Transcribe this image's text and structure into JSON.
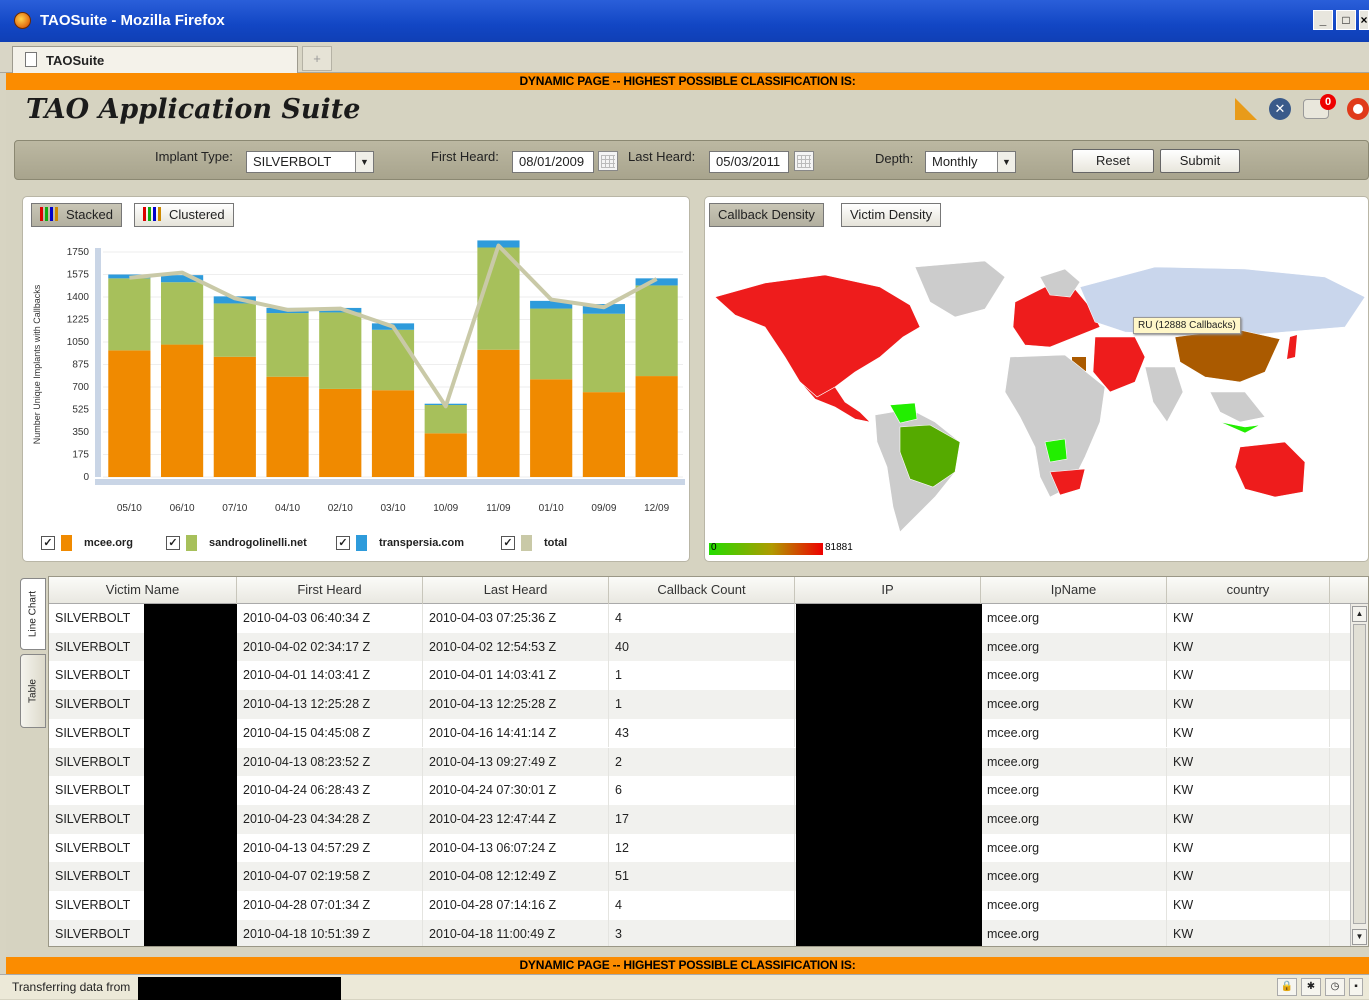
{
  "window": {
    "title": "TAOSuite - Mozilla Firefox",
    "tab_label": "TAOSuite",
    "new_tab": "+"
  },
  "banner": {
    "text": "DYNAMIC PAGE -- HIGHEST POSSIBLE CLASSIFICATION IS:"
  },
  "app": {
    "title": "TAO Application Suite",
    "notification_count": "0"
  },
  "filters": {
    "implant_type_label": "Implant Type:",
    "implant_type_value": "SILVERBOLT",
    "first_heard_label": "First Heard:",
    "first_heard_value": "08/01/2009",
    "last_heard_label": "Last Heard:",
    "last_heard_value": "05/03/2011",
    "depth_label": "Depth:",
    "depth_value": "Monthly",
    "reset_label": "Reset",
    "submit_label": "Submit"
  },
  "chart_panel": {
    "stacked_label": "Stacked",
    "clustered_label": "Clustered"
  },
  "chart_data": {
    "type": "bar",
    "stacked": true,
    "ylabel": "Number Unique Implants with Callbacks",
    "xlabel": "",
    "ylim": [
      0,
      1750
    ],
    "yticks": [
      0,
      175,
      350,
      525,
      700,
      875,
      1050,
      1225,
      1400,
      1575,
      1750
    ],
    "categories": [
      "05/10",
      "06/10",
      "07/10",
      "04/10",
      "02/10",
      "03/10",
      "10/09",
      "11/09",
      "01/10",
      "09/09",
      "12/09"
    ],
    "series": [
      {
        "name": "mcee.org",
        "color": "#f08a00",
        "values": [
          985,
          1030,
          935,
          780,
          685,
          675,
          340,
          990,
          760,
          660,
          785
        ]
      },
      {
        "name": "sandrogolinelli.net",
        "color": "#a7c05b",
        "values": [
          560,
          485,
          415,
          495,
          595,
          470,
          220,
          795,
          550,
          610,
          705
        ]
      },
      {
        "name": "transpersia.com",
        "color": "#2e9bdb",
        "values": [
          30,
          55,
          55,
          40,
          35,
          50,
          10,
          55,
          60,
          75,
          55
        ]
      },
      {
        "name": "total",
        "color": "#c9c9a7",
        "type": "line",
        "values": [
          1550,
          1590,
          1390,
          1300,
          1310,
          1170,
          550,
          1800,
          1380,
          1320,
          1540
        ]
      }
    ],
    "legend": "bottom"
  },
  "map_panel": {
    "callback_density_label": "Callback Density",
    "victim_density_label": "Victim Density",
    "tooltip": "RU (12888 Callbacks)",
    "scale_min": "0",
    "scale_max": "81881"
  },
  "side_tabs": {
    "line_chart": "Line Chart",
    "table": "Table"
  },
  "table": {
    "columns": [
      "Victim Name",
      "First Heard",
      "Last Heard",
      "Callback Count",
      "IP",
      "IpName",
      "country"
    ],
    "rows": [
      [
        "SILVERBOLT",
        "2010-04-03 06:40:34 Z",
        "2010-04-03 07:25:36 Z",
        "4",
        "",
        "mcee.org",
        "KW"
      ],
      [
        "SILVERBOLT",
        "2010-04-02 02:34:17 Z",
        "2010-04-02 12:54:53 Z",
        "40",
        "",
        "mcee.org",
        "KW"
      ],
      [
        "SILVERBOLT",
        "2010-04-01 14:03:41 Z",
        "2010-04-01 14:03:41 Z",
        "1",
        "",
        "mcee.org",
        "KW"
      ],
      [
        "SILVERBOLT",
        "2010-04-13 12:25:28 Z",
        "2010-04-13 12:25:28 Z",
        "1",
        "",
        "mcee.org",
        "KW"
      ],
      [
        "SILVERBOLT",
        "2010-04-15 04:45:08 Z",
        "2010-04-16 14:41:14 Z",
        "43",
        "",
        "mcee.org",
        "KW"
      ],
      [
        "SILVERBOLT",
        "2010-04-13 08:23:52 Z",
        "2010-04-13 09:27:49 Z",
        "2",
        "",
        "mcee.org",
        "KW"
      ],
      [
        "SILVERBOLT",
        "2010-04-24 06:28:43 Z",
        "2010-04-24 07:30:01 Z",
        "6",
        "",
        "mcee.org",
        "KW"
      ],
      [
        "SILVERBOLT",
        "2010-04-23 04:34:28 Z",
        "2010-04-23 12:47:44 Z",
        "17",
        "",
        "mcee.org",
        "KW"
      ],
      [
        "SILVERBOLT",
        "2010-04-13 04:57:29 Z",
        "2010-04-13 06:07:24 Z",
        "12",
        "",
        "mcee.org",
        "KW"
      ],
      [
        "SILVERBOLT",
        "2010-04-07 02:19:58 Z",
        "2010-04-08 12:12:49 Z",
        "51",
        "",
        "mcee.org",
        "KW"
      ],
      [
        "SILVERBOLT",
        "2010-04-28 07:01:34 Z",
        "2010-04-28 07:14:16 Z",
        "4",
        "",
        "mcee.org",
        "KW"
      ],
      [
        "SILVERBOLT",
        "2010-04-18 10:51:39 Z",
        "2010-04-18 11:00:49 Z",
        "3",
        "",
        "mcee.org",
        "KW"
      ]
    ]
  },
  "status": {
    "text": "Transferring data from"
  }
}
